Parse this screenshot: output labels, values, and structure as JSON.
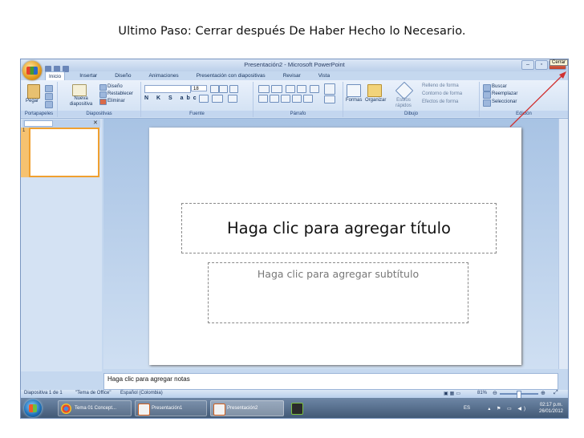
{
  "caption": "Ultimo Paso: Cerrar después De Haber Hecho lo Necesario.",
  "window": {
    "title": "Presentación2 - Microsoft PowerPoint",
    "close_tooltip": "Cerrar"
  },
  "tabs": [
    "Inicio",
    "Insertar",
    "Diseño",
    "Animaciones",
    "Presentación con diapositivas",
    "Revisar",
    "Vista"
  ],
  "ribbon": {
    "clipboard": {
      "paste": "Pegar",
      "label": "Portapapeles"
    },
    "slides": {
      "new_slide": "Nueva diapositiva",
      "layout": "Diseño",
      "reset": "Restablecer",
      "delete": "Eliminar",
      "label": "Diapositivas"
    },
    "font": {
      "size": "18",
      "label": "Fuente"
    },
    "paragraph": {
      "label": "Párrafo"
    },
    "drawing": {
      "shapes": "Formas",
      "arrange": "Organizar",
      "quick_styles": "Estilos rápidos",
      "fill": "Relleno de forma",
      "outline": "Contorno de forma",
      "effects": "Efectos de forma",
      "label": "Dibujo"
    },
    "editing": {
      "find": "Buscar",
      "replace": "Reemplazar",
      "select": "Seleccionar",
      "label": "Edición"
    }
  },
  "slide": {
    "title_placeholder": "Haga clic para agregar título",
    "subtitle_placeholder": "Haga clic para agregar subtítulo",
    "thumb_number": "1"
  },
  "notes": "Haga clic para agregar notas",
  "status": {
    "slide_of": "Diapositiva 1 de 1",
    "theme": "\"Tema de Office\"",
    "language": "Español (Colombia)",
    "zoom": "81%"
  },
  "taskbar": {
    "items": [
      "Tema 01 Concept...",
      "Presentación1",
      "Presentación2"
    ],
    "lang": "ES",
    "time": "02:17 p.m.",
    "date": "26/01/2012"
  },
  "colors": {
    "accent": "#f0a030",
    "taskbar": "#3e5572",
    "arrow": "#d03030"
  }
}
